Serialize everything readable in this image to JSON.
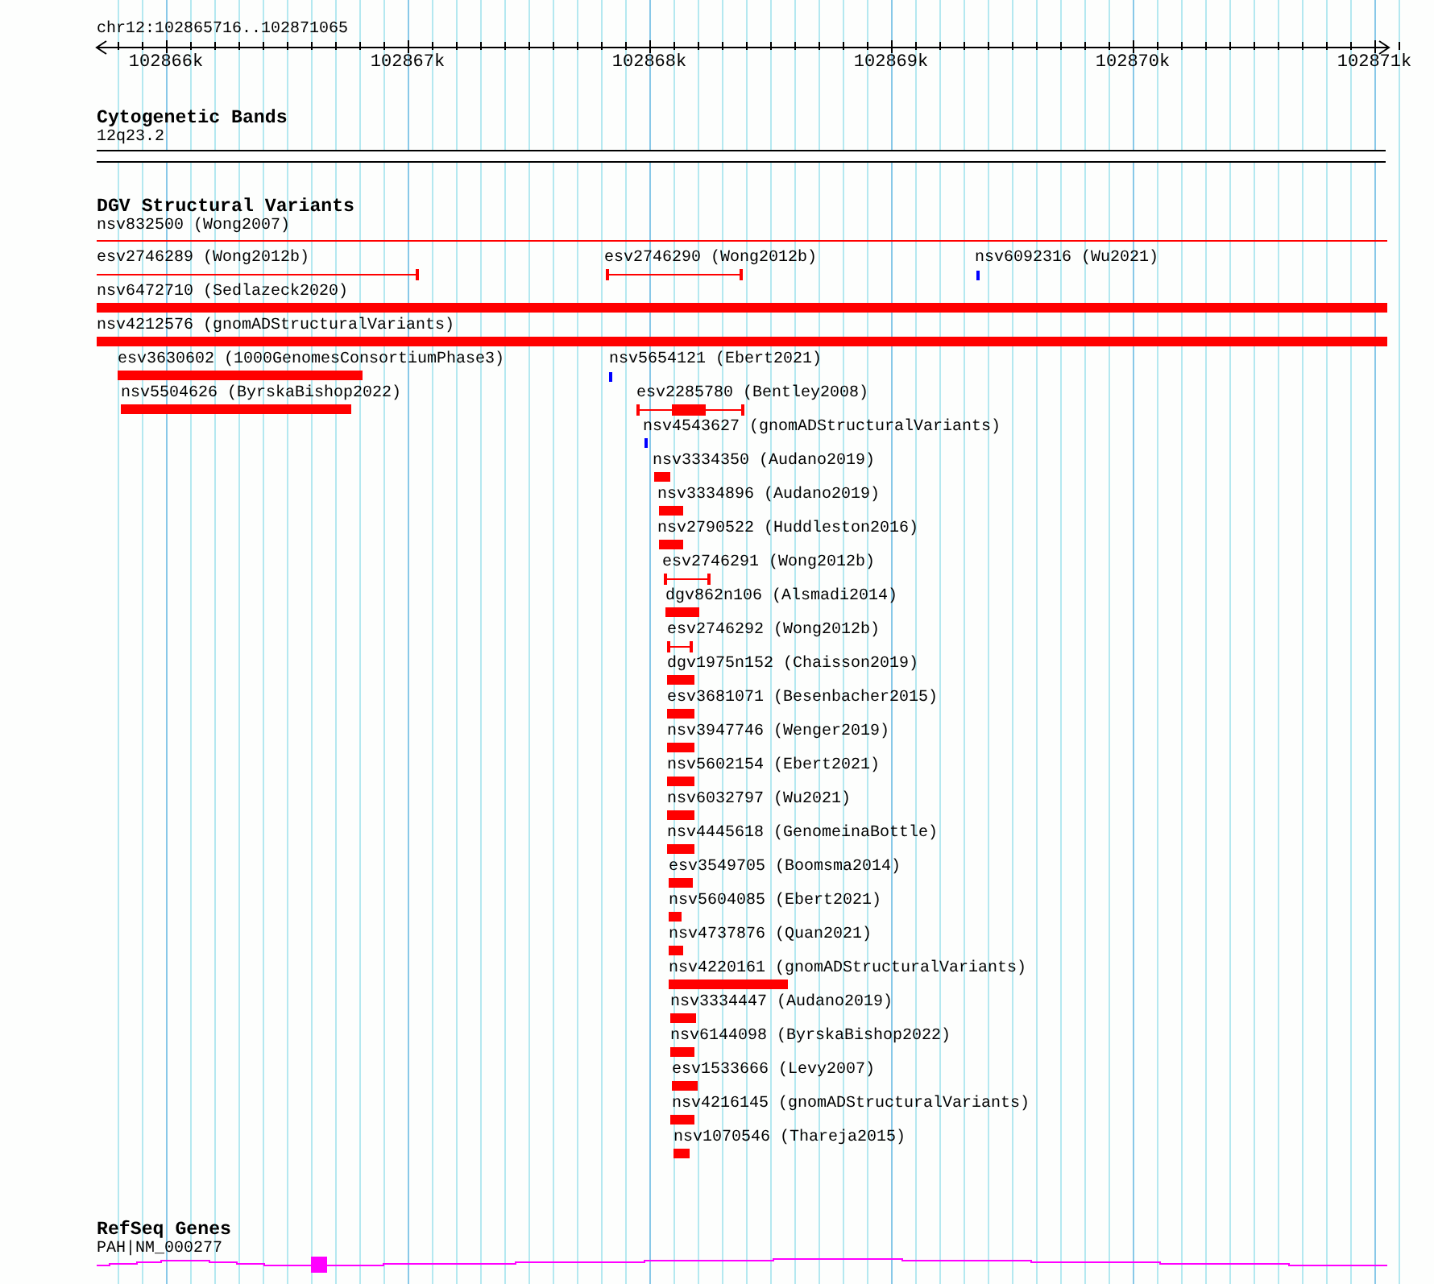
{
  "ruler": {
    "location": "chr12:102865716..102871065",
    "ticks": [
      "102866k",
      "102867k",
      "102868k",
      "102869k",
      "102870k",
      "102871k"
    ]
  },
  "tracks": [
    {
      "kind": "cytoband",
      "title": "Cytogenetic Bands",
      "band": "12q23.2"
    },
    {
      "kind": "variants",
      "title": "DGV Structural Variants",
      "features": [
        {
          "label": "nsv832500 (Wong2007)",
          "kind": "line"
        },
        {
          "label": "esv2746289 (Wong2012b)",
          "kind": "span"
        },
        {
          "label": "esv2746290 (Wong2012b)",
          "kind": "span"
        },
        {
          "label": "nsv6092316 (Wu2021)",
          "kind": "point"
        },
        {
          "label": "nsv6472710 (Sedlazeck2020)",
          "kind": "bar"
        },
        {
          "label": "nsv4212576 (gnomADStructuralVariants)",
          "kind": "bar"
        },
        {
          "label": "esv3630602 (1000GenomesConsortiumPhase3)",
          "kind": "bar"
        },
        {
          "label": "nsv5654121 (Ebert2021)",
          "kind": "point"
        },
        {
          "label": "nsv5504626 (ByrskaBishop2022)",
          "kind": "bar"
        },
        {
          "label": "esv2285780 (Bentley2008)",
          "kind": "span_with_bar"
        },
        {
          "label": "nsv4543627 (gnomADStructuralVariants)",
          "kind": "point"
        },
        {
          "label": "nsv3334350 (Audano2019)",
          "kind": "bar"
        },
        {
          "label": "nsv3334896 (Audano2019)",
          "kind": "bar"
        },
        {
          "label": "nsv2790522 (Huddleston2016)",
          "kind": "bar"
        },
        {
          "label": "esv2746291 (Wong2012b)",
          "kind": "span"
        },
        {
          "label": "dgv862n106 (Alsmadi2014)",
          "kind": "bar"
        },
        {
          "label": "esv2746292 (Wong2012b)",
          "kind": "span"
        },
        {
          "label": "dgv1975n152 (Chaisson2019)",
          "kind": "bar"
        },
        {
          "label": "esv3681071 (Besenbacher2015)",
          "kind": "bar"
        },
        {
          "label": "nsv3947746 (Wenger2019)",
          "kind": "bar"
        },
        {
          "label": "nsv5602154 (Ebert2021)",
          "kind": "bar"
        },
        {
          "label": "nsv6032797 (Wu2021)",
          "kind": "bar"
        },
        {
          "label": "nsv4445618 (GenomeinaBottle)",
          "kind": "bar"
        },
        {
          "label": "esv3549705 (Boomsma2014)",
          "kind": "bar"
        },
        {
          "label": "nsv5604085 (Ebert2021)",
          "kind": "bar"
        },
        {
          "label": "nsv4737876 (Quan2021)",
          "kind": "bar"
        },
        {
          "label": "nsv4220161 (gnomADStructuralVariants)",
          "kind": "bar"
        },
        {
          "label": "nsv3334447 (Audano2019)",
          "kind": "bar"
        },
        {
          "label": "nsv6144098 (ByrskaBishop2022)",
          "kind": "bar"
        },
        {
          "label": "esv1533666 (Levy2007)",
          "kind": "bar"
        },
        {
          "label": "nsv4216145 (gnomADStructuralVariants)",
          "kind": "bar"
        },
        {
          "label": "nsv1070546 (Thareja2015)",
          "kind": "bar"
        }
      ]
    },
    {
      "kind": "genes",
      "title": "RefSeq Genes",
      "gene": "PAH|NM_000277"
    }
  ]
}
